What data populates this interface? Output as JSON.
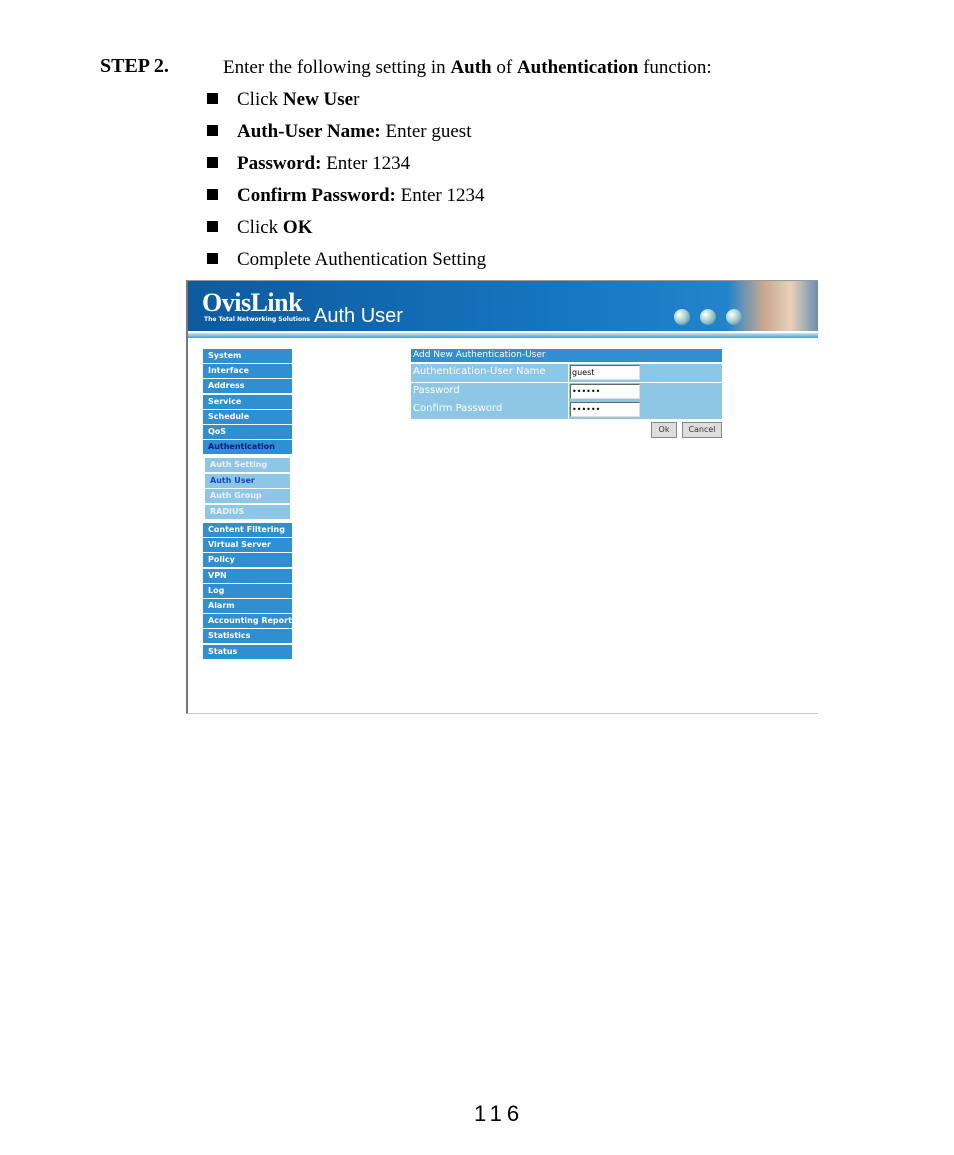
{
  "step": {
    "label": "STEP 2.",
    "intro_parts": [
      "Enter the following setting in ",
      "Auth",
      " of ",
      "Authentication",
      " function:"
    ]
  },
  "bullets": [
    {
      "pre": "Click ",
      "bold": "New Use",
      "post": "r"
    },
    {
      "pre": "",
      "bold": "Auth-User Name:",
      "post": " Enter guest"
    },
    {
      "pre": "",
      "bold": "Password:",
      "post": " Enter 1234"
    },
    {
      "pre": "",
      "bold": "Confirm Password:",
      "post": " Enter 1234"
    },
    {
      "pre": "Click ",
      "bold": "OK",
      "post": ""
    },
    {
      "pre": "Complete Authentication Setting",
      "bold": "",
      "post": ""
    }
  ],
  "screenshot": {
    "logo": "OvisLink",
    "tagline": "The Total Networking Solutions",
    "title": "Auth User",
    "nav": [
      "System",
      "Interface",
      "Address",
      "Service",
      "Schedule",
      "QoS",
      "Authentication"
    ],
    "subnav": [
      "Auth Setting",
      "Auth User",
      "Auth Group",
      "RADIUS"
    ],
    "nav2": [
      "Content Filtering",
      "Virtual Server",
      "Policy",
      "VPN",
      "Log",
      "Alarm",
      "Accounting Report",
      "Statistics",
      "Status"
    ],
    "form": {
      "header": "Add New Authentication-User",
      "rows": [
        {
          "label": "Authentication-User Name",
          "value": "guest"
        },
        {
          "label": "Password",
          "value": "••••••"
        },
        {
          "label": "Confirm Password",
          "value": "••••••"
        }
      ],
      "ok": "Ok",
      "cancel": "Cancel"
    },
    "colors": {
      "header": "#0d5a9e",
      "nav": "#2f8fd0",
      "subnav": "#8ec6e6"
    }
  },
  "page_number": "116"
}
